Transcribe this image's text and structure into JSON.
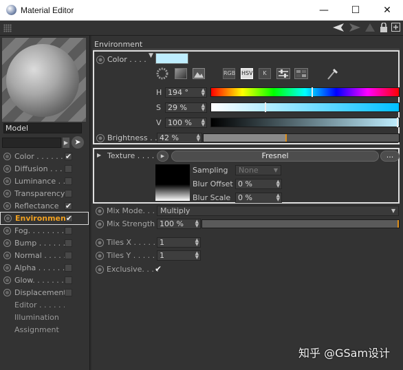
{
  "window": {
    "title": "Material Editor",
    "minimize": "—",
    "maximize": "☐",
    "close": "✕"
  },
  "preview": {
    "model_name": "Model"
  },
  "channels": [
    {
      "label": "Color . . . . . . .",
      "checked": true
    },
    {
      "label": "Diffusion . . . .",
      "checked": false
    },
    {
      "label": "Luminance . . . .",
      "checked": false
    },
    {
      "label": "Transparency",
      "checked": false
    },
    {
      "label": "Reflectance",
      "checked": true
    },
    {
      "label": "Environment",
      "checked": true,
      "selected": true
    },
    {
      "label": "Fog. . . . . . . .",
      "checked": false
    },
    {
      "label": "Bump . . . . . .",
      "checked": false
    },
    {
      "label": "Normal . . . . .",
      "checked": false
    },
    {
      "label": "Alpha . . . . . .",
      "checked": false
    },
    {
      "label": "Glow. . . . . . .",
      "checked": false
    },
    {
      "label": "Displacement",
      "checked": false
    },
    {
      "label": "Editor . . . . . .",
      "checked": null
    },
    {
      "label": "Illumination",
      "checked": null
    },
    {
      "label": "Assignment",
      "checked": null
    }
  ],
  "section_title": "Environment",
  "color": {
    "label": "Color . . . .",
    "swatch": "#bfeeff",
    "modes": [
      "RGB",
      "HSV",
      "K"
    ],
    "active_mode": "HSV",
    "h_label": "H",
    "h_value": "194 °",
    "h_fraction": 0.54,
    "s_label": "S",
    "s_value": "29 %",
    "s_fraction": 0.29,
    "v_label": "V",
    "v_value": "100 %",
    "v_fraction": 1.0
  },
  "brightness": {
    "label": "Brightness . .",
    "value": "42 %",
    "fraction": 0.42
  },
  "texture": {
    "label": "Texture . . . . . .",
    "shader": "Fresnel",
    "more": "...",
    "sampling_label": "Sampling",
    "sampling_value": "None",
    "blur_offset_label": "Blur Offset",
    "blur_offset_value": "0 %",
    "blur_scale_label": "Blur Scale",
    "blur_scale_value": "0 %"
  },
  "mix_mode": {
    "label": "Mix Mode. . . .",
    "value": "Multiply"
  },
  "mix_strength": {
    "label": "Mix Strength",
    "value": "100 %",
    "fraction": 1.0
  },
  "tiles_x": {
    "label": "Tiles X . . . . . .",
    "value": "1"
  },
  "tiles_y": {
    "label": "Tiles Y . . . . . .",
    "value": "1"
  },
  "exclusive": {
    "label": "Exclusive. . . .",
    "checked": true
  },
  "watermark": "知乎 @GSam设计",
  "colors": {
    "accent": "#f0a020",
    "panel": "#333333",
    "selection_border": "#e0e0e0"
  }
}
